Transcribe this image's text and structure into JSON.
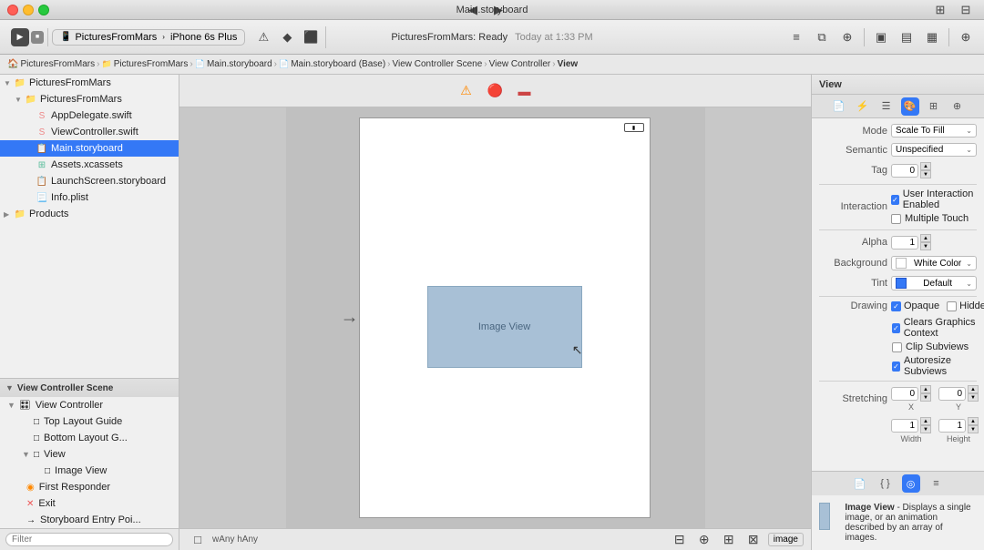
{
  "titlebar": {
    "title": "Main.storyboard",
    "run_btn": "▶",
    "stop_btn": "■"
  },
  "toolbar": {
    "scheme": "PicturesFromMars",
    "device": "iPhone 6s Plus",
    "status": "PicturesFromMars: Ready",
    "time": "Today at 1:33 PM"
  },
  "breadcrumb": {
    "items": [
      "PicturesFromMars",
      "PicturesFromMars",
      "Main.storyboard",
      "Main.storyboard (Base)",
      "View Controller Scene",
      "View Controller",
      "View"
    ]
  },
  "sidebar": {
    "header": "View Controller Scene",
    "items": [
      {
        "id": "view-controller-scene",
        "label": "View Controller Scene",
        "indent": 1,
        "disclosure": "▼",
        "icon": "📄"
      },
      {
        "id": "view-controller",
        "label": "View Controller",
        "indent": 2,
        "disclosure": "▼",
        "icon": "🎛"
      },
      {
        "id": "top-layout-guide",
        "label": "Top Layout Guide",
        "indent": 3,
        "disclosure": "",
        "icon": "□"
      },
      {
        "id": "bottom-layout-guide",
        "label": "Bottom Layout G...",
        "indent": 3,
        "disclosure": "",
        "icon": "□"
      },
      {
        "id": "view",
        "label": "View",
        "indent": 3,
        "disclosure": "▼",
        "icon": "□"
      },
      {
        "id": "image-view",
        "label": "Image View",
        "indent": 4,
        "disclosure": "",
        "icon": "□"
      },
      {
        "id": "first-responder",
        "label": "First Responder",
        "indent": 2,
        "disclosure": "",
        "icon": "🔶"
      },
      {
        "id": "exit",
        "label": "Exit",
        "indent": 2,
        "disclosure": "",
        "icon": "🔴"
      },
      {
        "id": "storyboard-entry",
        "label": "Storyboard Entry Poi...",
        "indent": 2,
        "disclosure": "",
        "icon": "→"
      }
    ],
    "project": {
      "root": "PicturesFromMars",
      "files": [
        {
          "id": "pictures-from-mars",
          "label": "PicturesFromMars",
          "indent": 1,
          "disclosure": "▼",
          "type": "folder"
        },
        {
          "id": "app-delegate",
          "label": "AppDelegate.swift",
          "indent": 2,
          "disclosure": "",
          "type": "swift"
        },
        {
          "id": "view-controller-swift",
          "label": "ViewController.swift",
          "indent": 2,
          "disclosure": "",
          "type": "swift"
        },
        {
          "id": "main-storyboard",
          "label": "Main.storyboard",
          "indent": 2,
          "disclosure": "",
          "type": "storyboard",
          "selected": true
        },
        {
          "id": "assets",
          "label": "Assets.xcassets",
          "indent": 2,
          "disclosure": "",
          "type": "assets"
        },
        {
          "id": "launch-storyboard",
          "label": "LaunchScreen.storyboard",
          "indent": 2,
          "disclosure": "",
          "type": "storyboard"
        },
        {
          "id": "info-plist",
          "label": "Info.plist",
          "indent": 2,
          "disclosure": "",
          "type": "plist"
        },
        {
          "id": "products",
          "label": "Products",
          "indent": 1,
          "disclosure": "▶",
          "type": "folder"
        }
      ]
    },
    "filter_placeholder": "Filter"
  },
  "canvas": {
    "image_view_label": "Image View",
    "size_hint": "wAny hAny",
    "bottom_label": "image"
  },
  "right_panel": {
    "title": "View",
    "mode_label": "Mode",
    "mode_value": "Scale To Fill",
    "semantic_label": "Semantic",
    "semantic_value": "Unspecified",
    "tag_label": "Tag",
    "tag_value": "0",
    "interaction_label": "Interaction",
    "user_interaction": "User Interaction Enabled",
    "multiple_touch": "Multiple Touch",
    "alpha_label": "Alpha",
    "alpha_value": "1",
    "background_label": "Background",
    "background_value": "White Color",
    "tint_label": "Tint",
    "tint_value": "Default",
    "drawing_label": "Drawing",
    "opaque": "Opaque",
    "hidden": "Hidden",
    "clears_graphics": "Clears Graphics Context",
    "clip_subviews": "Clip Subviews",
    "autoresize_subviews": "Autoresize Subviews",
    "stretching_label": "Stretching",
    "stretch_x": "0",
    "stretch_y": "0",
    "stretch_w": "1",
    "stretch_h": "1",
    "x_label": "X",
    "y_label": "Y",
    "width_label": "Width",
    "height_label": "Height",
    "image_view_title": "Image View",
    "image_view_desc": "- Displays a single image, or an animation described by an array of images.",
    "bottom_tab_active": "image"
  }
}
